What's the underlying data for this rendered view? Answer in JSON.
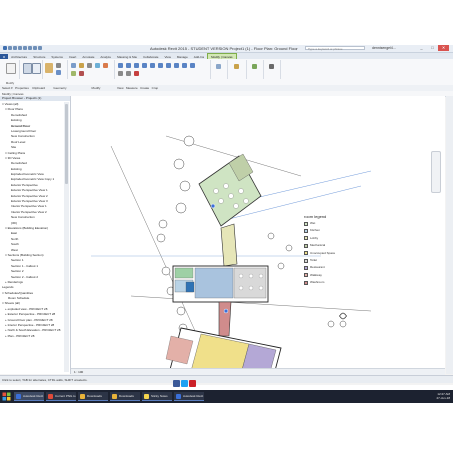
{
  "window": {
    "title": "Autodesk Revit 2015 - STUDENT VERSION    Project1 (1) - Floor Plan: Ground Floor",
    "search_placeholder": "Type a keyword or phrase",
    "user": "dennisengel4...",
    "buttons": [
      "_",
      "□",
      "✕"
    ]
  },
  "ribbon_tabs": [
    "R",
    "Architecture",
    "Structure",
    "Systems",
    "Insert",
    "Annotate",
    "Analyze",
    "Massing & Site",
    "Collaborate",
    "View",
    "Manage",
    "Add-Ins",
    "Modify | Canvas"
  ],
  "ribbon_groups": [
    "Modify",
    "Select",
    "Properties",
    "Clipboard",
    "Geometry",
    "Modify",
    "View",
    "Measure",
    "Create",
    "Crop"
  ],
  "select_bar": {
    "text": "Select ▾   Properties    Clipboard          Geometry                              Modify                    View   Measure   Create   Crop"
  },
  "context_bar": {
    "text": "Modify | Canvas"
  },
  "project_browser": {
    "title": "Project Browser - Project1 (1)",
    "items": [
      {
        "label": "□ Views (all)",
        "indent": 0,
        "bold": false
      },
      {
        "label": "□ Floor Plans",
        "indent": 1,
        "bold": false
      },
      {
        "label": "Demolished",
        "indent": 3,
        "bold": false
      },
      {
        "label": "Existing",
        "indent": 3,
        "bold": false
      },
      {
        "label": "Ground Floor",
        "indent": 3,
        "bold": true
      },
      {
        "label": "Lowerground Floor",
        "indent": 3,
        "bold": false
      },
      {
        "label": "New Construction",
        "indent": 3,
        "bold": false
      },
      {
        "label": "Roof Level",
        "indent": 3,
        "bold": false
      },
      {
        "label": "Site",
        "indent": 3,
        "bold": false
      },
      {
        "label": "□ Ceiling Plans",
        "indent": 1,
        "bold": false
      },
      {
        "label": "□ 3D Views",
        "indent": 1,
        "bold": false
      },
      {
        "label": "Demolished",
        "indent": 3,
        "bold": false
      },
      {
        "label": "Existing",
        "indent": 3,
        "bold": false
      },
      {
        "label": "Exploded Isometric View",
        "indent": 3,
        "bold": false
      },
      {
        "label": "Exploded Isometric View Copy 1",
        "indent": 3,
        "bold": false
      },
      {
        "label": "Exterior Perspective",
        "indent": 3,
        "bold": false
      },
      {
        "label": "Exterior Perspective View 1",
        "indent": 3,
        "bold": false
      },
      {
        "label": "Exterior Perspective View 2",
        "indent": 3,
        "bold": false
      },
      {
        "label": "Exterior Perspective View 3",
        "indent": 3,
        "bold": false
      },
      {
        "label": "Interior Perspective View 1",
        "indent": 3,
        "bold": false
      },
      {
        "label": "Interior Perspective View 2",
        "indent": 3,
        "bold": false
      },
      {
        "label": "New Construction",
        "indent": 3,
        "bold": false
      },
      {
        "label": "{3D}",
        "indent": 3,
        "bold": false
      },
      {
        "label": "□ Elevations (Building Elevation)",
        "indent": 1,
        "bold": false
      },
      {
        "label": "East",
        "indent": 3,
        "bold": false
      },
      {
        "label": "North",
        "indent": 3,
        "bold": false
      },
      {
        "label": "South",
        "indent": 3,
        "bold": false
      },
      {
        "label": "West",
        "indent": 3,
        "bold": false
      },
      {
        "label": "□ Sections (Building Section)",
        "indent": 1,
        "bold": false
      },
      {
        "label": "Section 1",
        "indent": 3,
        "bold": false
      },
      {
        "label": "Section 1 - Callout 1",
        "indent": 3,
        "bold": false
      },
      {
        "label": "Section 2",
        "indent": 3,
        "bold": false
      },
      {
        "label": "Section 2 - Callout 2",
        "indent": 3,
        "bold": false
      },
      {
        "label": "+ Renderings",
        "indent": 1,
        "bold": false
      },
      {
        "label": "Legends",
        "indent": 0,
        "bold": false
      },
      {
        "label": "□ Schedules/Quantities",
        "indent": 0,
        "bold": false
      },
      {
        "label": "Room Schedule",
        "indent": 2,
        "bold": false
      },
      {
        "label": "□ Sheets (all)",
        "indent": 0,
        "bold": false
      },
      {
        "label": "+ exploded view - PROJECT 28",
        "indent": 1,
        "bold": false
      },
      {
        "label": "+ Exterior Perspective - PROJECT 28",
        "indent": 1,
        "bold": false
      },
      {
        "label": "+ Ground Floor plan - PROJECT 28",
        "indent": 1,
        "bold": false
      },
      {
        "label": "+ Interior Perspective - PROJECT 28",
        "indent": 1,
        "bold": false
      },
      {
        "label": "+ North & South Elevation - PROJECT 28",
        "indent": 1,
        "bold": false
      },
      {
        "label": "+ Plan - PROJECT 28",
        "indent": 1,
        "bold": false
      }
    ]
  },
  "room_legend": {
    "title": "room legend",
    "items": [
      {
        "label": "Wet",
        "color": "#cfe4c3"
      },
      {
        "label": "Kitchen",
        "color": "#b9d3e6"
      },
      {
        "label": "Lobby",
        "color": "#e6e6b8"
      },
      {
        "label": "Mechanical",
        "color": "#bfcfa8"
      },
      {
        "label": "Unoccupied Space",
        "color": "#f0e08a"
      },
      {
        "label": "Toilet",
        "color": "#d9d9d9"
      },
      {
        "label": "Restaurant",
        "color": "#b4a8d6"
      },
      {
        "label": "Walkway",
        "color": "#e3b0a8"
      },
      {
        "label": "Washroom",
        "color": "#d08c8c"
      }
    ]
  },
  "status_bar": {
    "text": "Click to select, TAB for alternates, CTRL adds, SHIFT unselects."
  },
  "view_bar": {
    "scale": "1 : 100"
  },
  "taskbar": {
    "items": [
      {
        "label": "Autodesk Revit 2015",
        "color": "#3a6fd8",
        "active": true
      },
      {
        "label": "Current PNG to P3...",
        "color": "#e04b3a",
        "active": false
      },
      {
        "label": "Downloads",
        "color": "#e8b33a",
        "active": false
      },
      {
        "label": "Downloads",
        "color": "#e8b33a",
        "active": false
      },
      {
        "label": "Sticky Notes",
        "color": "#f3d44d",
        "active": false
      },
      {
        "label": "Autodesk Revit 20...",
        "color": "#3a6fd8",
        "active": false
      }
    ],
    "time": "12:27 AM",
    "date": "27-Jun-18"
  },
  "social_icons": [
    {
      "name": "facebook-icon",
      "color": "#3b5998"
    },
    {
      "name": "twitter-icon",
      "color": "#1da1f2"
    },
    {
      "name": "pinterest-icon",
      "color": "#cb2027"
    }
  ]
}
